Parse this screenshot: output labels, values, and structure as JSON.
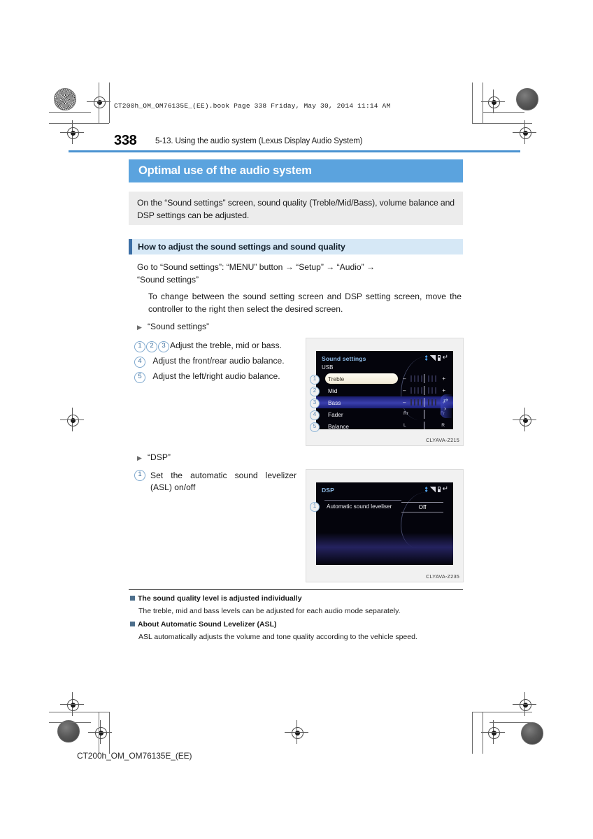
{
  "header": {
    "file_stamp": "CT200h_OM_OM76135E_(EE).book  Page 338  Friday, May 30, 2014  11:14 AM",
    "page_number": "338",
    "chapter_title": "5-13. Using the audio system (Lexus Display Audio System)"
  },
  "section": {
    "banner_title": "Optimal use of the audio system",
    "intro": "On the “Sound settings” screen, sound quality (Treble/Mid/Bass), volume balance and DSP settings can be adjusted.",
    "sub_banner_title": "How to adjust the sound settings and sound quality"
  },
  "body": {
    "path_line1": "Go to “Sound settings”: “MENU” button  →  “Setup”  →  “Audio”  →",
    "path_line2": "“Sound settings”",
    "note_indent": "To change between the sound setting screen and DSP setting screen, move the controller to the right then select the desired screen.",
    "subhead_sound_settings": "“Sound settings”",
    "subhead_dsp": "“DSP”"
  },
  "callout_list_sound": [
    {
      "numbers": [
        "1",
        "2",
        "3"
      ],
      "text": "Adjust the treble, mid or bass."
    },
    {
      "numbers": [
        "4"
      ],
      "text": "Adjust the front/rear audio balance."
    },
    {
      "numbers": [
        "5"
      ],
      "text": "Adjust the left/right audio balance."
    }
  ],
  "callout_list_dsp": [
    {
      "numbers": [
        "1"
      ],
      "text": "Set the automatic sound levelizer (ASL) on/off"
    }
  ],
  "figure_sound": {
    "caption": "CLYAVA-Z215",
    "screen_title": "Sound settings",
    "screen_source": "USB",
    "status_icons": [
      "bluetooth-icon",
      "signal-icon",
      "battery-icon",
      "back-icon"
    ],
    "rows": [
      {
        "callout": "1",
        "label": "Treble",
        "left": "–",
        "right": "+",
        "state": "selected"
      },
      {
        "callout": "2",
        "label": "Mid",
        "left": "–",
        "right": "+",
        "state": "normal"
      },
      {
        "callout": "3",
        "label": "Bass",
        "left": "–",
        "right": "+",
        "state": "highlighted"
      },
      {
        "callout": "4",
        "label": "Fader",
        "left": "Rr",
        "right": "Fr",
        "state": "normal"
      },
      {
        "callout": "5",
        "label": "Balance",
        "left": "L",
        "right": "R",
        "state": "normal"
      }
    ]
  },
  "figure_dsp": {
    "caption": "CLYAVA-Z235",
    "screen_title": "DSP",
    "status_icons": [
      "bluetooth-icon",
      "signal-icon",
      "battery-icon",
      "back-icon"
    ],
    "row_callout": "1",
    "row_label": "Automatic sound leveliser",
    "row_value": "Off"
  },
  "notes": [
    {
      "heading": "The sound quality level is adjusted individually",
      "text": "The treble, mid and bass levels can be adjusted for each audio mode separately."
    },
    {
      "heading": "About Automatic Sound Levelizer (ASL)",
      "text": "ASL automatically adjusts the volume and tone quality according to the vehicle speed."
    }
  ],
  "footer": {
    "text": "CT200h_OM_OM76135E_(EE)"
  },
  "colors": {
    "banner_blue": "#5ba3de",
    "rule_blue": "#4b93d1",
    "sub_banner_blue": "#d6e8f6",
    "intro_grey": "#ececec",
    "callout_blue": "#3d6f9e"
  }
}
